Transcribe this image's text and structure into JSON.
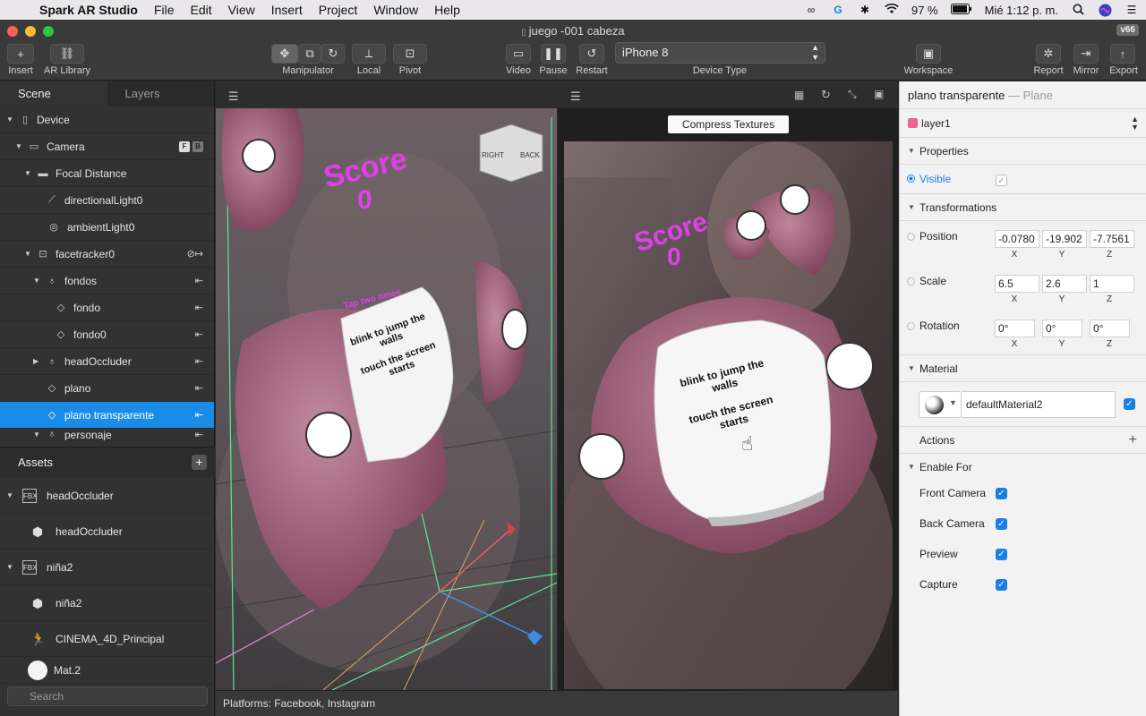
{
  "menubar": {
    "app_name": "Spark AR Studio",
    "menus": [
      "File",
      "Edit",
      "View",
      "Insert",
      "Project",
      "Window",
      "Help"
    ],
    "battery": "97 %",
    "clock": "Mié 1:12 p. m."
  },
  "window": {
    "title": "juego -001 cabeza",
    "version": "v66"
  },
  "toolbar": {
    "insert": "Insert",
    "ar_library": "AR Library",
    "manipulator": "Manipulator",
    "local": "Local",
    "pivot": "Pivot",
    "video": "Video",
    "pause": "Pause",
    "restart": "Restart",
    "device_value": "iPhone 8",
    "device_type": "Device Type",
    "workspace": "Workspace",
    "report": "Report",
    "mirror": "Mirror",
    "export": "Export"
  },
  "scene": {
    "tabs": [
      "Scene",
      "Layers"
    ],
    "items": [
      {
        "label": "Device"
      },
      {
        "label": "Camera"
      },
      {
        "label": "Focal Distance"
      },
      {
        "label": "directionalLight0"
      },
      {
        "label": "ambientLight0"
      },
      {
        "label": "facetracker0"
      },
      {
        "label": "fondos"
      },
      {
        "label": "fondo"
      },
      {
        "label": "fondo0"
      },
      {
        "label": "headOccluder"
      },
      {
        "label": "plano"
      },
      {
        "label": "plano transparente"
      },
      {
        "label": "personaje"
      }
    ],
    "camera_badges": [
      "F",
      "B"
    ]
  },
  "assets": {
    "title": "Assets",
    "items": [
      {
        "label": "headOccluder",
        "tag": "FBX"
      },
      {
        "label": "headOccluder"
      },
      {
        "label": "niña2",
        "tag": "FBX"
      },
      {
        "label": "niña2"
      },
      {
        "label": "CINEMA_4D_Principal"
      },
      {
        "label": "Mat.2"
      }
    ],
    "search_placeholder": "Search"
  },
  "viewport": {
    "gizmo_right": "RIGHT",
    "gizmo_back": "BACK",
    "score_label": "Score",
    "score_value": "0",
    "card_line1": "blink to jump the walls",
    "card_line2": "touch the screen starts",
    "tap_text": "Tap two times",
    "compress_textures": "Compress Textures",
    "platforms": "Platforms: Facebook, Instagram"
  },
  "inspector": {
    "object_name": "plano transparente",
    "object_type": "Plane",
    "layer": "layer1",
    "layer_color": "#f06292",
    "properties": "Properties",
    "visible": "Visible",
    "transformations": "Transformations",
    "position_label": "Position",
    "position": [
      "-0.0780",
      "-19.902",
      "-7.7561"
    ],
    "scale_label": "Scale",
    "scale": [
      "6.5",
      "2.6",
      "1"
    ],
    "rotation_label": "Rotation",
    "rotation": [
      "0°",
      "0°",
      "0°"
    ],
    "axes": [
      "X",
      "Y",
      "Z"
    ],
    "material": "Material",
    "material_value": "defaultMaterial2",
    "actions": "Actions",
    "enable_for": "Enable For",
    "front_camera": "Front Camera",
    "back_camera": "Back Camera",
    "preview": "Preview",
    "capture": "Capture"
  },
  "colors": {
    "accent": "#1a8ce8",
    "score_magenta": "#e040e8"
  }
}
